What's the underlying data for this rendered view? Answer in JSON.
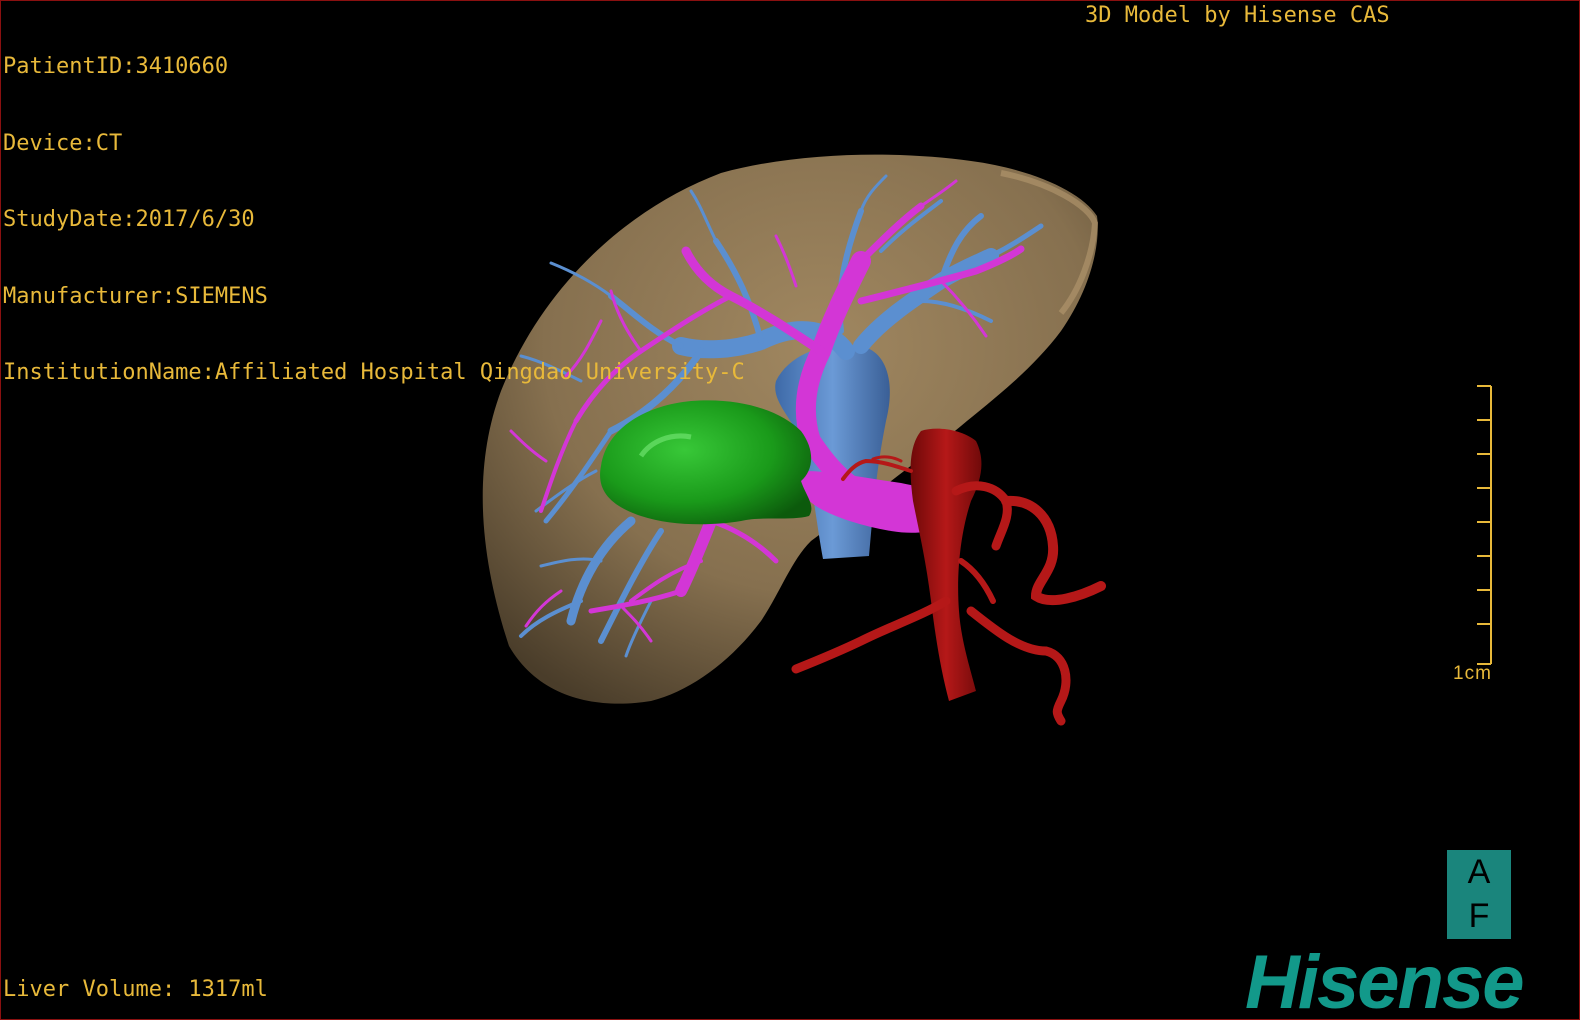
{
  "study_info": {
    "patient_id": "PatientID:3410660",
    "device": "Device:CT",
    "study_date": "StudyDate:2017/6/30",
    "manufacturer": "Manufacturer:SIEMENS",
    "institution": "InstitutionName:Affiliated Hospital Qingdao University-C"
  },
  "header_brand": "3D Model by Hisense CAS",
  "liver_volume": "Liver Volume: 1317ml",
  "scale": {
    "label": "1cm"
  },
  "orientation_cube": {
    "top": "A",
    "bottom": "F"
  },
  "logo_text": "Hisense",
  "colors": {
    "overlay_text": "#e8b93a",
    "liver": "#8c7352",
    "hepatic_vein": "#5b8fd0",
    "portal_vein": "#d336d6",
    "tumor": "#1e9a1e",
    "artery": "#b01515",
    "brand": "#12998a"
  }
}
